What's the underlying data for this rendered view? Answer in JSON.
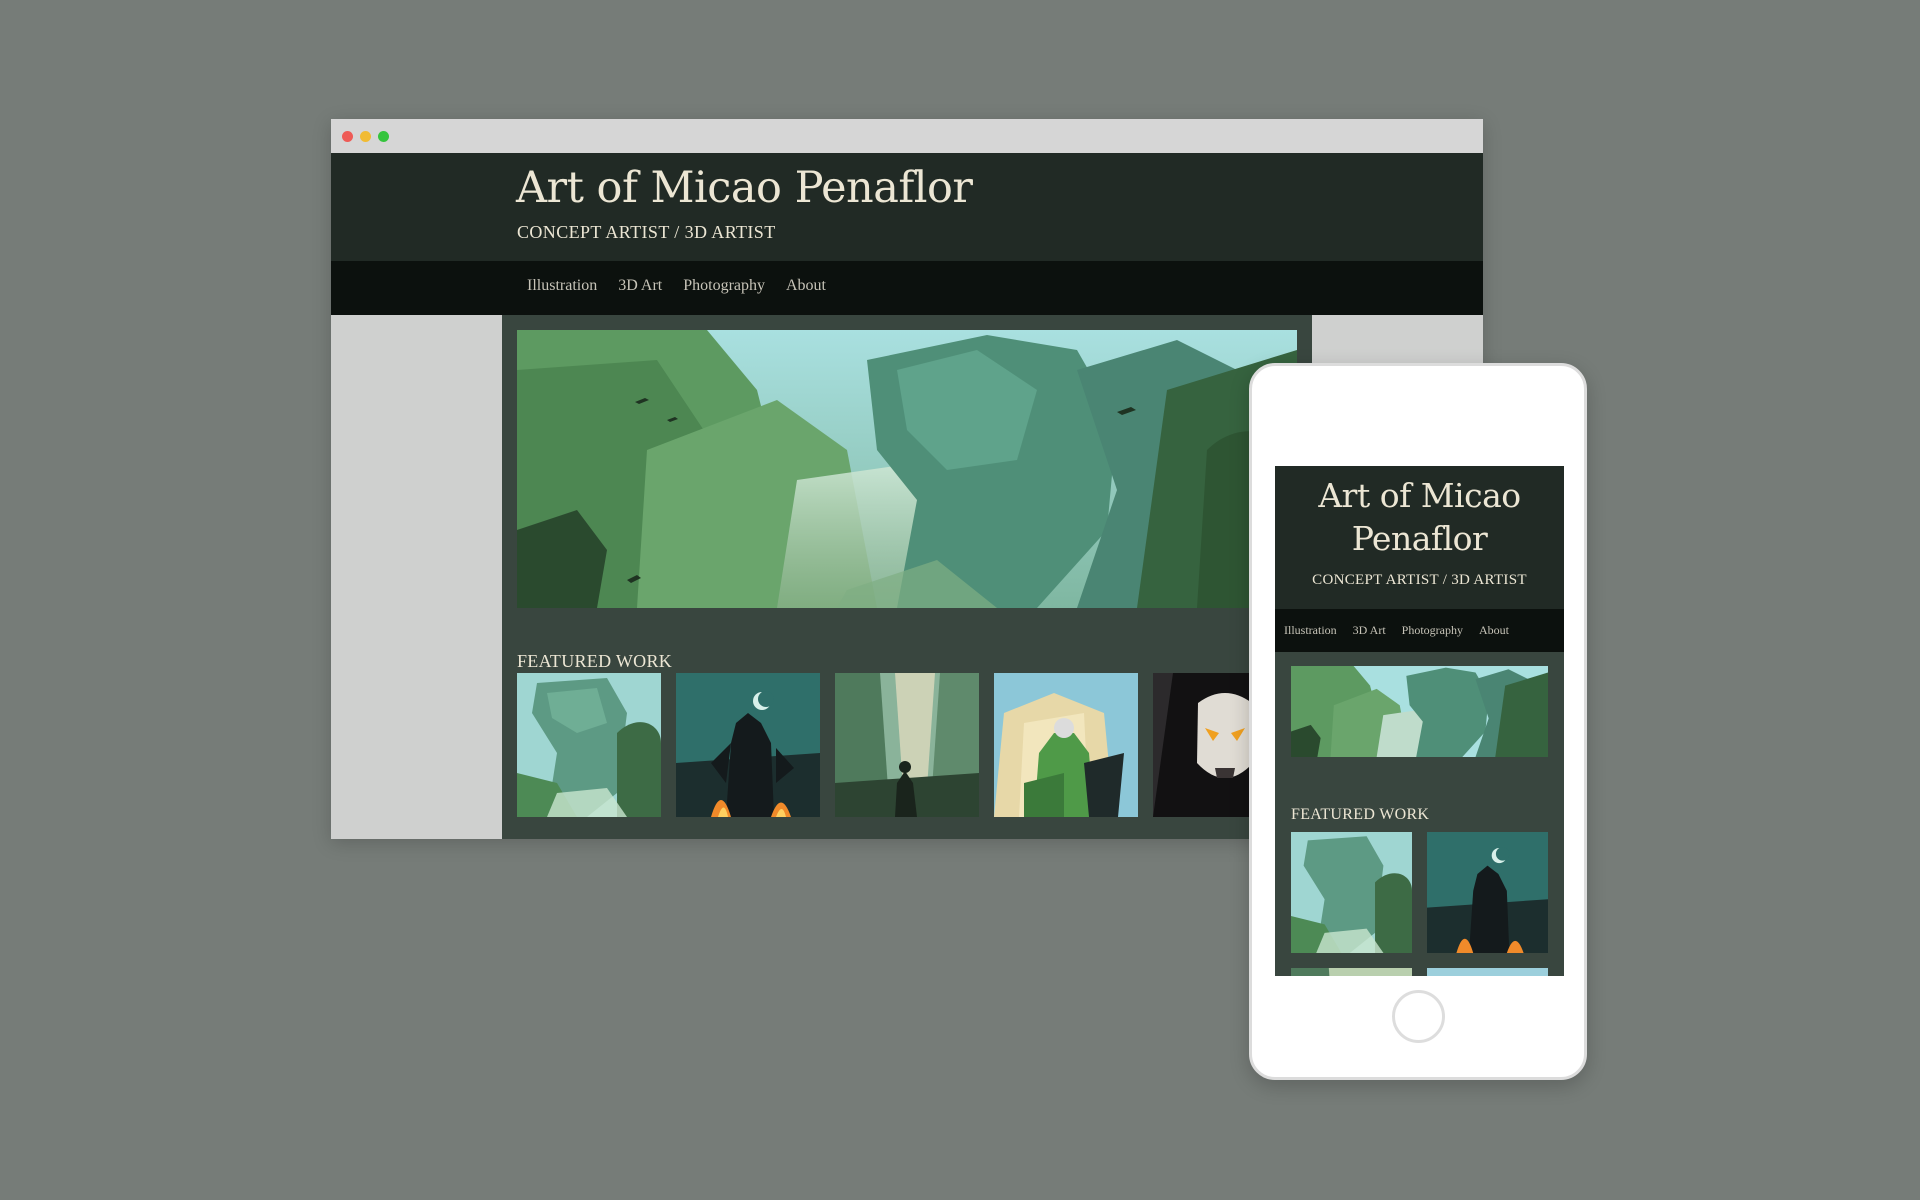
{
  "site": {
    "title": "Art of Micao Penaflor",
    "tagline": "CONCEPT ARTIST / 3D ARTIST",
    "nav": [
      "Illustration",
      "3D Art",
      "Photography",
      "About"
    ],
    "featured_heading": "FEATURED WORK"
  },
  "mobile": {
    "title_line1": "Art of Micao",
    "title_line2": "Penaflor"
  },
  "artwork": {
    "hero": "cliffside-landscape-painting",
    "thumbnails": [
      "stone-giant-landscape",
      "dark-armored-warrior-with-fire",
      "wanderer-in-misty-ruins",
      "green-armored-knight-with-shield",
      "skull-masked-rider"
    ]
  },
  "colors": {
    "page_background": "#767c78",
    "header_background": "#212a25",
    "nav_background": "#0c110e",
    "content_background": "#39463f",
    "title_text": "#ece6d4",
    "nav_text": "#c7c4b8"
  }
}
